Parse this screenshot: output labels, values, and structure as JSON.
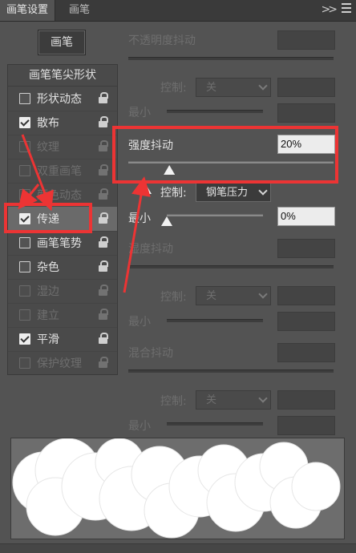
{
  "tabs": [
    {
      "label": "画笔设置",
      "active": true
    },
    {
      "label": "画笔",
      "active": false
    }
  ],
  "presets_button": "画笔",
  "tip_shape_title": "画笔笔尖形状",
  "categories": [
    {
      "label": "形状动态",
      "checked": false,
      "enabled": true
    },
    {
      "label": "散布",
      "checked": true,
      "enabled": true
    },
    {
      "label": "纹理",
      "checked": false,
      "enabled": false
    },
    {
      "label": "双重画笔",
      "checked": false,
      "enabled": false
    },
    {
      "label": "颜色动态",
      "checked": false,
      "enabled": false
    },
    {
      "label": "传递",
      "checked": true,
      "enabled": true,
      "selected": true
    },
    {
      "label": "画笔笔势",
      "checked": false,
      "enabled": true
    },
    {
      "label": "杂色",
      "checked": false,
      "enabled": true
    },
    {
      "label": "湿边",
      "checked": false,
      "enabled": false
    },
    {
      "label": "建立",
      "checked": false,
      "enabled": false
    },
    {
      "label": "平滑",
      "checked": true,
      "enabled": true
    },
    {
      "label": "保护纹理",
      "checked": false,
      "enabled": false
    }
  ],
  "settings": {
    "opacity_jitter": {
      "label": "不透明度抖动"
    },
    "control_label": "控制:",
    "control_off": "关",
    "minimum_label": "最小",
    "flow_jitter": {
      "label": "强度抖动",
      "value": "20%",
      "slider": 0.2
    },
    "flow_control": {
      "value": "钢笔压力"
    },
    "flow_minimum": {
      "value": "0%",
      "slider": 0.0
    },
    "wetness_jitter": {
      "label": "湿度抖动"
    },
    "mix_jitter": {
      "label": "混合抖动"
    }
  },
  "colors": {
    "annotation": "#ec3434",
    "panel": "#535353",
    "preview_bg": "#6d6d6d"
  }
}
